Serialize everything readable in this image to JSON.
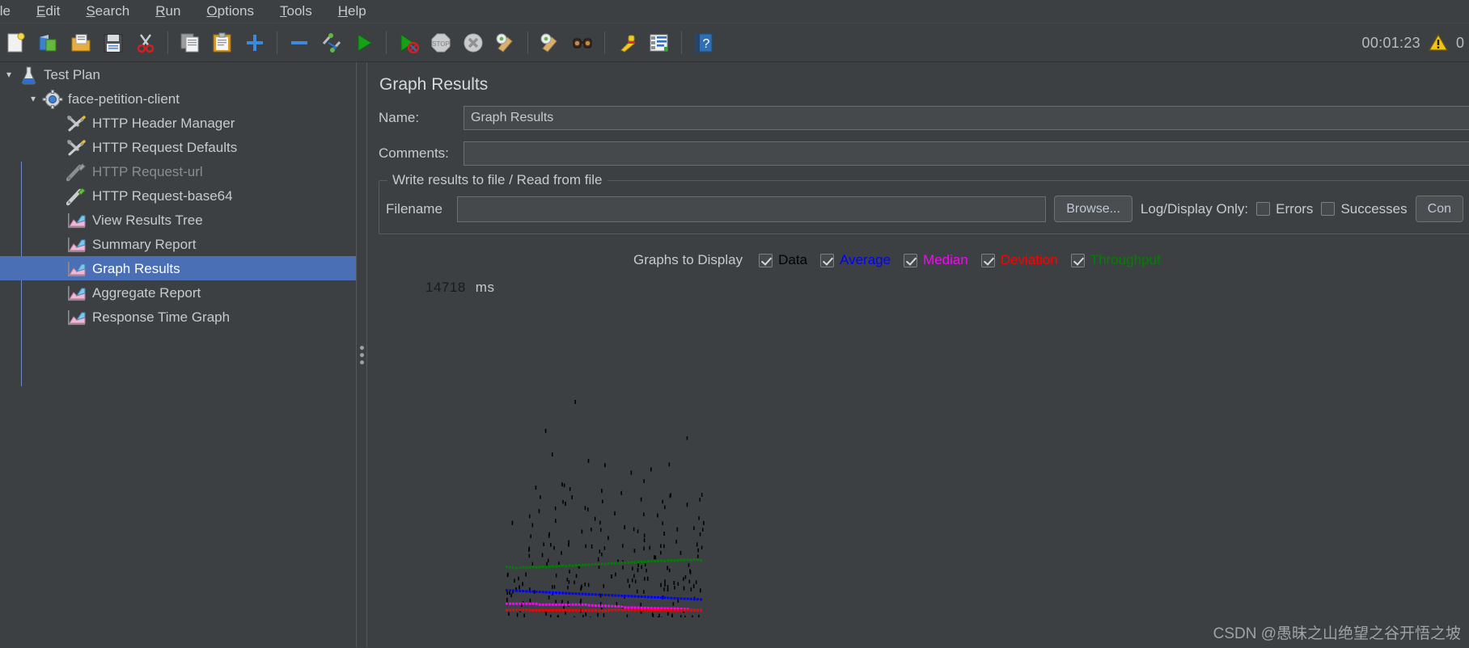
{
  "menubar": {
    "items": [
      {
        "label": "ile",
        "mnemonic": ""
      },
      {
        "label": "Edit",
        "mnemonic": "E"
      },
      {
        "label": "Search",
        "mnemonic": "S"
      },
      {
        "label": "Run",
        "mnemonic": "R"
      },
      {
        "label": "Options",
        "mnemonic": "O"
      },
      {
        "label": "Tools",
        "mnemonic": "T"
      },
      {
        "label": "Help",
        "mnemonic": "H"
      }
    ]
  },
  "toolbar": {
    "buttons": [
      {
        "name": "new-icon",
        "title": "New"
      },
      {
        "name": "templates-icon",
        "title": "Templates"
      },
      {
        "name": "open-icon",
        "title": "Open"
      },
      {
        "name": "save-icon",
        "title": "Save"
      },
      {
        "name": "cut-icon",
        "title": "Cut"
      },
      {
        "name": "copy-icon",
        "title": "Copy"
      },
      {
        "name": "paste-icon",
        "title": "Paste"
      },
      {
        "name": "expand-all-icon",
        "title": "Expand"
      },
      {
        "name": "collapse-all-icon",
        "title": "Collapse"
      },
      {
        "name": "toggle-icon",
        "title": "Toggle"
      },
      {
        "name": "start-icon",
        "title": "Start"
      },
      {
        "name": "start-no-pauses-icon",
        "title": "Start no pauses"
      },
      {
        "name": "stop-icon",
        "title": "Stop"
      },
      {
        "name": "shutdown-icon",
        "title": "Shutdown"
      },
      {
        "name": "clear-icon",
        "title": "Clear"
      },
      {
        "name": "clear-all-icon",
        "title": "Clear All"
      },
      {
        "name": "search-icon",
        "title": "Search"
      },
      {
        "name": "reset-search-icon",
        "title": "Reset Search"
      },
      {
        "name": "function-helper-icon",
        "title": "Function Helper Dialog"
      },
      {
        "name": "help-icon",
        "title": "Help"
      }
    ],
    "clock": "00:01:23",
    "error_count": "0",
    "warning_icon": "warning-triangle-icon"
  },
  "tree": {
    "items": [
      {
        "label": "Test Plan",
        "icon": "test-plan-icon",
        "depth": 0,
        "twisty": "▾",
        "selected": false,
        "disabled": false
      },
      {
        "label": "face-petition-client",
        "icon": "thread-group-icon",
        "depth": 1,
        "twisty": "▾",
        "selected": false,
        "disabled": false
      },
      {
        "label": "HTTP Header Manager",
        "icon": "config-element-icon",
        "depth": 2,
        "twisty": "",
        "selected": false,
        "disabled": false
      },
      {
        "label": "HTTP Request Defaults",
        "icon": "config-element-icon",
        "depth": 2,
        "twisty": "",
        "selected": false,
        "disabled": false
      },
      {
        "label": "HTTP Request-url",
        "icon": "http-request-disabled-icon",
        "depth": 2,
        "twisty": "",
        "selected": false,
        "disabled": true
      },
      {
        "label": "HTTP Request-base64",
        "icon": "http-request-icon",
        "depth": 2,
        "twisty": "",
        "selected": false,
        "disabled": false
      },
      {
        "label": "View Results Tree",
        "icon": "listener-icon",
        "depth": 2,
        "twisty": "",
        "selected": false,
        "disabled": false
      },
      {
        "label": "Summary Report",
        "icon": "listener-icon",
        "depth": 2,
        "twisty": "",
        "selected": false,
        "disabled": false
      },
      {
        "label": "Graph Results",
        "icon": "listener-icon",
        "depth": 2,
        "twisty": "",
        "selected": true,
        "disabled": false
      },
      {
        "label": "Aggregate Report",
        "icon": "listener-icon",
        "depth": 2,
        "twisty": "",
        "selected": false,
        "disabled": false
      },
      {
        "label": "Response Time Graph",
        "icon": "listener-icon",
        "depth": 2,
        "twisty": "",
        "selected": false,
        "disabled": false
      }
    ]
  },
  "splitter": {
    "name": "panel-splitter",
    "handle_icon": "grip-dots-icon"
  },
  "panel": {
    "title": "Graph Results",
    "name_label": "Name:",
    "name_value": "Graph Results",
    "name_placeholder": "",
    "comments_label": "Comments:",
    "comments_value": "",
    "comments_placeholder": "",
    "file_group_legend": "Write results to file / Read from file",
    "filename_label": "Filename",
    "filename_value": "",
    "filename_placeholder": "",
    "browse_label": "Browse...",
    "log_display_label": "Log/Display Only:",
    "errors_label": "Errors",
    "errors_checked": false,
    "successes_label": "Successes",
    "successes_checked": false,
    "configure_label": "Con"
  },
  "graphs_to_display": {
    "title": "Graphs to Display",
    "options": [
      {
        "label": "Data",
        "color": "#000000",
        "checked": true
      },
      {
        "label": "Average",
        "color": "#0000ff",
        "checked": true
      },
      {
        "label": "Median",
        "color": "#ff00ff",
        "checked": true
      },
      {
        "label": "Deviation",
        "color": "#ff0000",
        "checked": true
      },
      {
        "label": "Throughput",
        "color": "#008000",
        "checked": true
      }
    ]
  },
  "chart_data": {
    "type": "line",
    "title": "",
    "xlabel": "",
    "ylabel": "ms",
    "y_max_label": "14718",
    "y_unit": "ms",
    "ylim": [
      0,
      14718
    ],
    "grid": false,
    "legend": "none",
    "series": [
      {
        "name": "Throughput",
        "color": "#008000",
        "values": [
          2420,
          2400,
          2370,
          2355,
          2380,
          2395,
          2375,
          2390,
          2410,
          2385,
          2400,
          2415,
          2395,
          2420,
          2440,
          2430,
          2450,
          2465,
          2445,
          2470,
          2460,
          2485,
          2500,
          2490,
          2515,
          2505,
          2525,
          2540,
          2530,
          2550,
          2545,
          2565,
          2580,
          2570,
          2590,
          2605,
          2595,
          2615,
          2630,
          2620,
          2640,
          2655,
          2645,
          2665,
          2680,
          2670,
          2690,
          2700,
          2685,
          2705,
          2715,
          2700,
          2720,
          2735,
          2725,
          2745,
          2730,
          2750,
          2740,
          2720
        ]
      },
      {
        "name": "Average",
        "color": "#0000ff",
        "values": [
          1320,
          1310,
          1300,
          1295,
          1285,
          1280,
          1270,
          1262,
          1255,
          1248,
          1240,
          1233,
          1226,
          1218,
          1212,
          1205,
          1198,
          1190,
          1183,
          1176,
          1168,
          1162,
          1155,
          1148,
          1140,
          1133,
          1126,
          1120,
          1112,
          1105,
          1098,
          1090,
          1084,
          1076,
          1070,
          1062,
          1055,
          1048,
          1040,
          1034,
          1026,
          1018,
          1012,
          1005,
          998,
          990,
          984,
          976,
          970,
          962,
          955,
          948,
          940,
          934,
          926,
          920,
          912,
          906,
          898,
          892
        ]
      },
      {
        "name": "Median",
        "color": "#ff00ff",
        "values": [
          690,
          690,
          690,
          690,
          690,
          690,
          690,
          690,
          690,
          690,
          650,
          650,
          650,
          650,
          650,
          650,
          650,
          650,
          650,
          650,
          650,
          650,
          650,
          650,
          648,
          620,
          610,
          605,
          600,
          596,
          590,
          585,
          578,
          572,
          566,
          560,
          520,
          515,
          512,
          508,
          504,
          500,
          496,
          492,
          488,
          484,
          480,
          476,
          472,
          468,
          464,
          460,
          456,
          450,
          442,
          436,
          400,
          396,
          392,
          390
        ]
      },
      {
        "name": "Deviation",
        "color": "#ff0000",
        "values": [
          395,
          398,
          400,
          402,
          404,
          402,
          399,
          396,
          380,
          384,
          386,
          388,
          386,
          384,
          386,
          388,
          386,
          385,
          387,
          386,
          385,
          384,
          383,
          382,
          381,
          380,
          378,
          372,
          368,
          365,
          370,
          378,
          400,
          404,
          402,
          400,
          399,
          398,
          397,
          396,
          395,
          394,
          393,
          392,
          391,
          390,
          389,
          388,
          387,
          386,
          380,
          372,
          366,
          370,
          378,
          385,
          388,
          390,
          392,
          393
        ]
      }
    ],
    "scatter": {
      "name": "Data",
      "color": "#000000",
      "points": [
        [
          21,
          10150
        ],
        [
          12,
          8800
        ],
        [
          14,
          7700
        ],
        [
          25,
          7400
        ],
        [
          30,
          7200
        ],
        [
          44,
          7000
        ],
        [
          38,
          6850
        ],
        [
          17,
          6300
        ],
        [
          9,
          6150
        ],
        [
          29,
          6000
        ],
        [
          35,
          5900
        ],
        [
          50,
          5800
        ],
        [
          20,
          5700
        ],
        [
          41,
          5600
        ],
        [
          18,
          5400
        ],
        [
          55,
          5350
        ],
        [
          24,
          5200
        ],
        [
          10,
          5050
        ],
        [
          33,
          4950
        ],
        [
          46,
          4850
        ],
        [
          27,
          4700
        ],
        [
          15,
          4600
        ],
        [
          60,
          4500
        ],
        [
          8,
          4400
        ],
        [
          36,
          4300
        ],
        [
          52,
          4200
        ],
        [
          23,
          4100
        ],
        [
          48,
          4000
        ],
        [
          13,
          3900
        ],
        [
          31,
          3800
        ],
        [
          42,
          3700
        ],
        [
          19,
          3600
        ],
        [
          58,
          3500
        ],
        [
          26,
          3400
        ],
        [
          7,
          3300
        ],
        [
          39,
          3200
        ],
        [
          53,
          3100
        ],
        [
          11,
          3000
        ],
        [
          45,
          2900
        ],
        [
          28,
          2800
        ],
        [
          34,
          2700
        ],
        [
          16,
          2600
        ],
        [
          22,
          2500
        ],
        [
          49,
          2400
        ],
        [
          40,
          2300
        ],
        [
          56,
          2200
        ],
        [
          6,
          2100
        ],
        [
          32,
          2000
        ],
        [
          43,
          1900
        ],
        [
          37,
          1800
        ],
        [
          51,
          1700
        ],
        [
          5,
          1650
        ],
        [
          47,
          1600
        ],
        [
          57,
          1550
        ],
        [
          4,
          1500
        ],
        [
          54,
          1450
        ],
        [
          3,
          1400
        ],
        [
          59,
          1350
        ],
        [
          2,
          1300
        ],
        [
          1,
          1250
        ]
      ]
    }
  },
  "watermark": "CSDN @愚昧之山绝望之谷开悟之坡"
}
